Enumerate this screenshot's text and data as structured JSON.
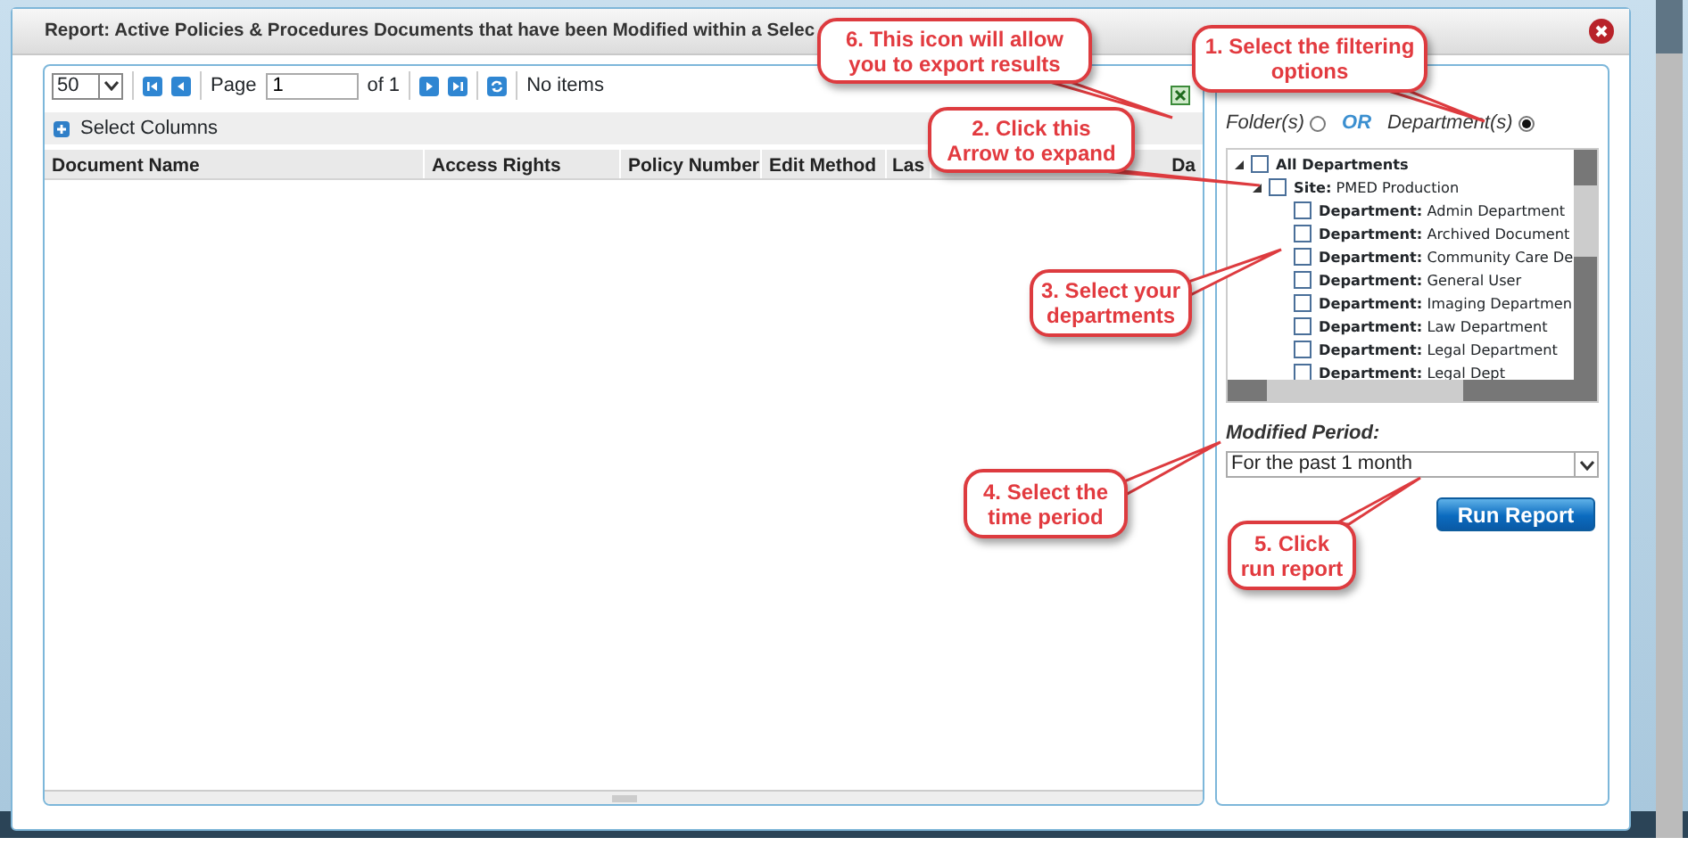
{
  "window": {
    "title": "Report: Active Policies & Procedures Documents that have been Modified within a Selec"
  },
  "grid": {
    "page_size": "50",
    "page_label": "Page",
    "page": "1",
    "page_of": "of 1",
    "status": "No items",
    "select_columns": "Select Columns",
    "columns": [
      "Document Name",
      "Access Rights",
      "Policy Number",
      "Edit Method",
      "Las",
      "Da"
    ]
  },
  "filter": {
    "options": [
      {
        "label": "Folder(s)",
        "selected": false
      },
      {
        "label": "Department(s)",
        "selected": true
      }
    ],
    "or_label": "OR",
    "tree": [
      {
        "label": "All Departments",
        "checked": false,
        "expanded": true,
        "children": [
          {
            "label": "**Site:** PMED Production",
            "checked": false,
            "expanded": true,
            "children": [
              {
                "label": "**Department:** Admin Department",
                "checked": false
              },
              {
                "label": "**Department:** Archived Document",
                "checked": false
              },
              {
                "label": "**Department:** Community Care De",
                "checked": false
              },
              {
                "label": "**Department:** General User",
                "checked": false
              },
              {
                "label": "**Department:** Imaging Departmen",
                "checked": false
              },
              {
                "label": "**Department:** Law Department",
                "checked": false
              },
              {
                "label": "**Department:** Legal Department",
                "checked": false
              },
              {
                "label": "**Department:** Legal Dept",
                "checked": false
              }
            ]
          }
        ]
      }
    ],
    "period_label": "Modified Period:",
    "period": "For the past 1 month",
    "run_button": "Run Report"
  },
  "callouts": [
    {
      "lines": [
        "6. This icon will allow",
        "you to export results"
      ]
    },
    {
      "lines": [
        "1. Select the filtering",
        "options"
      ]
    },
    {
      "lines": [
        "2. Click this",
        "Arrow to expand"
      ]
    },
    {
      "lines": [
        "3. Select your",
        "departments"
      ]
    },
    {
      "lines": [
        "4. Select the",
        "time period"
      ]
    },
    {
      "lines": [
        "5. Click",
        "run report"
      ]
    }
  ]
}
